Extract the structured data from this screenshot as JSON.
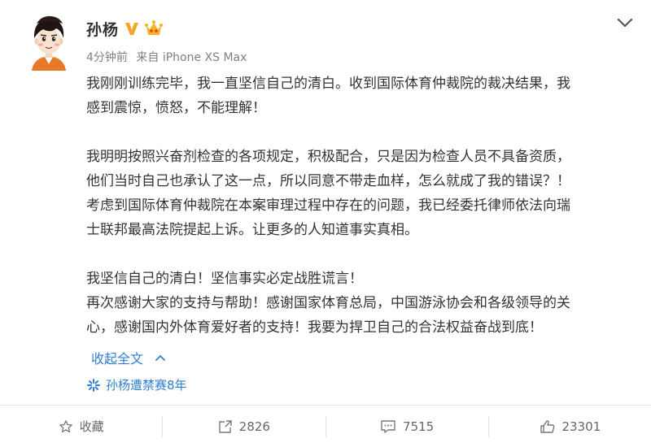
{
  "post": {
    "author": "孙杨",
    "time": "4分钟前",
    "source": "来自 iPhone XS Max",
    "paragraphs": [
      [
        "我刚刚训练完毕，我一直坚信自己的清白。收到国际体育仲裁院的裁决结果，我",
        "感到震惊，愤怒，不能理解！"
      ],
      [
        "我明明按照兴奋剂检查的各项规定，积极配合，只是因为检查人员不具备资质，",
        "他们当时自己也承认了这一点，所以同意不带走血样，怎么就成了我的错误？！",
        "考虑到国际体育仲裁院在本案审理过程中存在的问题，我已经委托律师依法向瑞",
        "士联邦最高法院提起上诉。让更多的人知道事实真相。"
      ],
      [
        "我坚信自己的清白！坚信事实必定战胜谎言！",
        "再次感谢大家的支持与帮助！感谢国家体育总局，中国游泳协会和各级领导的关",
        "心，感谢国内外体育爱好者的支持！我要为捍卫自己的合法权益奋战到底！"
      ]
    ],
    "collapse_label": "收起全文",
    "topic": "孙杨遭禁赛8年"
  },
  "actions": {
    "favorite": "收藏",
    "repost": "2826",
    "comment": "7515",
    "like": "23301"
  },
  "colors": {
    "link": "#2f7fd0",
    "text": "#333333",
    "meta": "#808080",
    "vbadge": "#f5a623",
    "crown": "#f3b420"
  }
}
